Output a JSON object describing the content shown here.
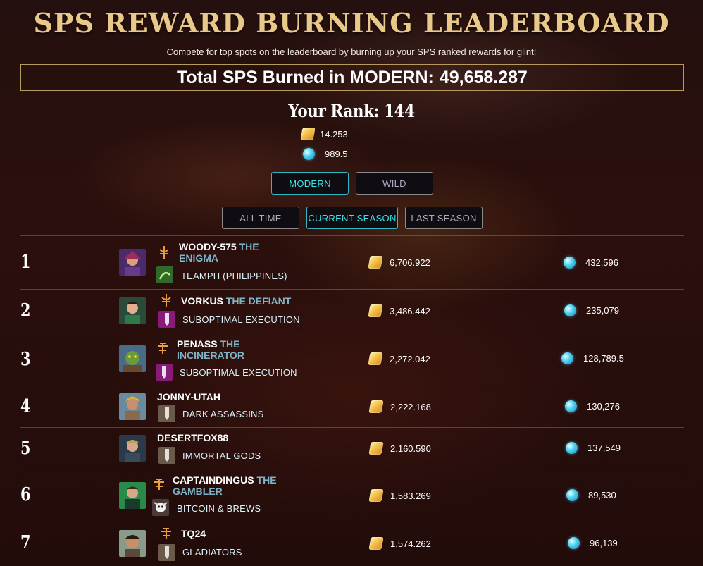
{
  "header": {
    "title": "SPS REWARD BURNING LEADERBOARD",
    "subtitle": "Compete for top spots on the leaderboard by burning up your SPS ranked rewards for glint!",
    "total_label": "Total SPS Burned in MODERN:",
    "total_value": "49,658.287"
  },
  "your_rank": {
    "label": "Your Rank: 144",
    "sps": "14.253",
    "glint": "989.5"
  },
  "format_tabs": [
    {
      "label": "MODERN",
      "active": true
    },
    {
      "label": "WILD",
      "active": false
    }
  ],
  "period_tabs": [
    {
      "label": "ALL TIME",
      "active": false
    },
    {
      "label": "CURRENT SEASON",
      "active": true
    },
    {
      "label": "LAST SEASON",
      "active": false
    }
  ],
  "icons": {
    "sps": "sps-token-icon",
    "glint": "glint-orb-icon",
    "league": "league-emblem-icon",
    "guild": "guild-banner-icon"
  },
  "colors": {
    "title_gold": "#e8c98a",
    "active_cyan": "#35e3ea",
    "epithet_blue": "#7fb3c8"
  },
  "leaderboard": [
    {
      "rank": "1",
      "name": "WOODY-575",
      "epithet": "THE ENIGMA",
      "guild": "TEAMPH (PHILIPPINES)",
      "sps": "6,706.922",
      "glint": "432,596"
    },
    {
      "rank": "2",
      "name": "VORKUS",
      "epithet": "THE DEFIANT",
      "guild": "SUBOPTIMAL EXECUTION",
      "sps": "3,486.442",
      "glint": "235,079"
    },
    {
      "rank": "3",
      "name": "PENASS",
      "epithet": "THE INCINERATOR",
      "guild": "SUBOPTIMAL EXECUTION",
      "sps": "2,272.042",
      "glint": "128,789.5"
    },
    {
      "rank": "4",
      "name": "JONNY-UTAH",
      "epithet": "",
      "guild": "DARK ASSASSINS",
      "sps": "2,222.168",
      "glint": "130,276"
    },
    {
      "rank": "5",
      "name": "DESERTFOX88",
      "epithet": "",
      "guild": "IMMORTAL GODS",
      "sps": "2,160.590",
      "glint": "137,549"
    },
    {
      "rank": "6",
      "name": "CAPTAINDINGUS",
      "epithet": "THE GAMBLER",
      "guild": "BITCOIN & BREWS",
      "sps": "1,583.269",
      "glint": "89,530"
    },
    {
      "rank": "7",
      "name": "TQ24",
      "epithet": "",
      "guild": "GLADIATORS",
      "sps": "1,574.262",
      "glint": "96,139"
    }
  ]
}
